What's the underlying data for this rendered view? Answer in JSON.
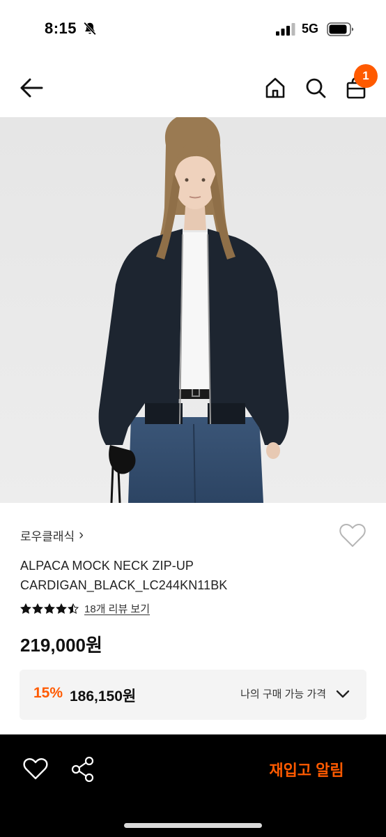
{
  "status_bar": {
    "time": "8:15",
    "network": "5G",
    "icons": [
      "bell-slash-icon",
      "signal-icon",
      "battery-icon"
    ]
  },
  "nav": {
    "icons": [
      "arrow-left-icon",
      "home-icon",
      "search-icon",
      "shopping-bag-icon"
    ],
    "cart_badge": "1"
  },
  "product": {
    "image": "product-photo",
    "brand": "로우클래식",
    "brand_chevron": "›",
    "title": "ALPACA MOCK NECK ZIP-UP CARDIGAN_BLACK_LC244KN11BK",
    "rating": 4.5,
    "review_link": "18개 리뷰 보기",
    "price": "219,000원"
  },
  "discount": {
    "rate": "15%",
    "price": "186,150원",
    "toggle_label": "나의 구매 가능 가격"
  },
  "bottom_bar": {
    "restock_label": "재입고 알림",
    "icons": [
      "heart-icon",
      "share-icon"
    ]
  },
  "colors": {
    "accent": "#ff5a00",
    "bottom_bar_bg": "#000000",
    "discount_bg": "#f4f4f4"
  }
}
